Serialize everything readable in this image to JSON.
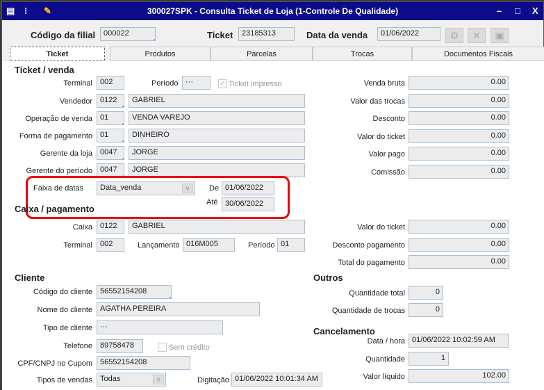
{
  "window": {
    "title": "300027SPK - Consulta Ticket de Loja (1-Controle De Qualidade)",
    "controls": [
      "–",
      "□",
      "X"
    ]
  },
  "header": {
    "filial_label": "Código da filial",
    "filial": "000022",
    "ticket_label": "Ticket",
    "ticket": "23185313",
    "data_label": "Data da venda",
    "data": "01/06/2022"
  },
  "tabs": [
    "Ticket",
    "Produtos",
    "Parcelas",
    "Trocas",
    "Documentos Fiscais"
  ],
  "ticket_venda": {
    "title": "Ticket / venda",
    "terminal_label": "Terminal",
    "terminal": "002",
    "periodo_label": "Período",
    "periodo": "···",
    "impresso_label": "Ticket impresso",
    "rows": [
      {
        "label": "Vendedor",
        "code": "0122",
        "name": "GABRIEL"
      },
      {
        "label": "Operação de venda",
        "code": "01",
        "name": "VENDA VAREJO"
      },
      {
        "label": "Forma de pagamento",
        "code": "01",
        "name": "DINHEIRO"
      },
      {
        "label": "Gerente da loja",
        "code": "0047",
        "name": "JORGE"
      },
      {
        "label": "Gerente do período",
        "code": "0047",
        "name": "JORGE"
      }
    ],
    "faixa_label": "Faixa de datas",
    "faixa": "Data_venda",
    "de_label": "De",
    "de": "01/06/2022",
    "ate_label": "Até",
    "ate": "30/06/2022"
  },
  "valores": [
    {
      "label": "Venda bruta",
      "value": "0.00"
    },
    {
      "label": "Valor das trocas",
      "value": "0.00"
    },
    {
      "label": "Desconto",
      "value": "0.00"
    },
    {
      "label": "Valor do ticket",
      "value": "0.00"
    },
    {
      "label": "Valor pago",
      "value": "0.00"
    },
    {
      "label": "Comissão",
      "value": "0.00"
    }
  ],
  "caixa": {
    "title": "Caixa / pagamento",
    "caixa_label": "Caixa",
    "caixa_code": "0122",
    "caixa_name": "GABRIEL",
    "terminal_label": "Terminal",
    "terminal": "002",
    "lanc_label": "Lançamento",
    "lanc": "016M005",
    "periodo_label": "Período",
    "periodo": "01",
    "valores": [
      {
        "label": "Valor do ticket",
        "value": "0.00"
      },
      {
        "label": "Desconto pagamento",
        "value": "0.00"
      },
      {
        "label": "Total do pagamento",
        "value": "0.00"
      }
    ]
  },
  "cliente": {
    "title": "Cliente",
    "codigo_label": "Código do cliente",
    "codigo": "56552154208",
    "nome_label": "Nome do cliente",
    "nome": "AGATHA PEREIRA",
    "tipo_label": "Tipo de cliente",
    "tipo": "···",
    "tel_label": "Telefone",
    "tel": "89758478",
    "sem_credito": "Sem crédito",
    "cpf_label": "CPF/CNPJ no Cupom",
    "cpf": "56552154208",
    "tipos_label": "Tipos de vendas",
    "tipos": "Todas",
    "digitacao_label": "Digitação",
    "digitacao": "01/06/2022 10:01:34 AM"
  },
  "outros": {
    "title": "Outros",
    "qt_label": "Quantidade total",
    "qt": "0",
    "qtr_label": "Quantidade de trocas",
    "qtr": "0"
  },
  "cancelamento": {
    "title": "Cancelamento",
    "data_label": "Data / hora",
    "data": "01/06/2022 10:02:59 AM",
    "qtd_label": "Quantidade",
    "qtd": "1",
    "liq_label": "Valor líquido",
    "liq": "102.00"
  }
}
